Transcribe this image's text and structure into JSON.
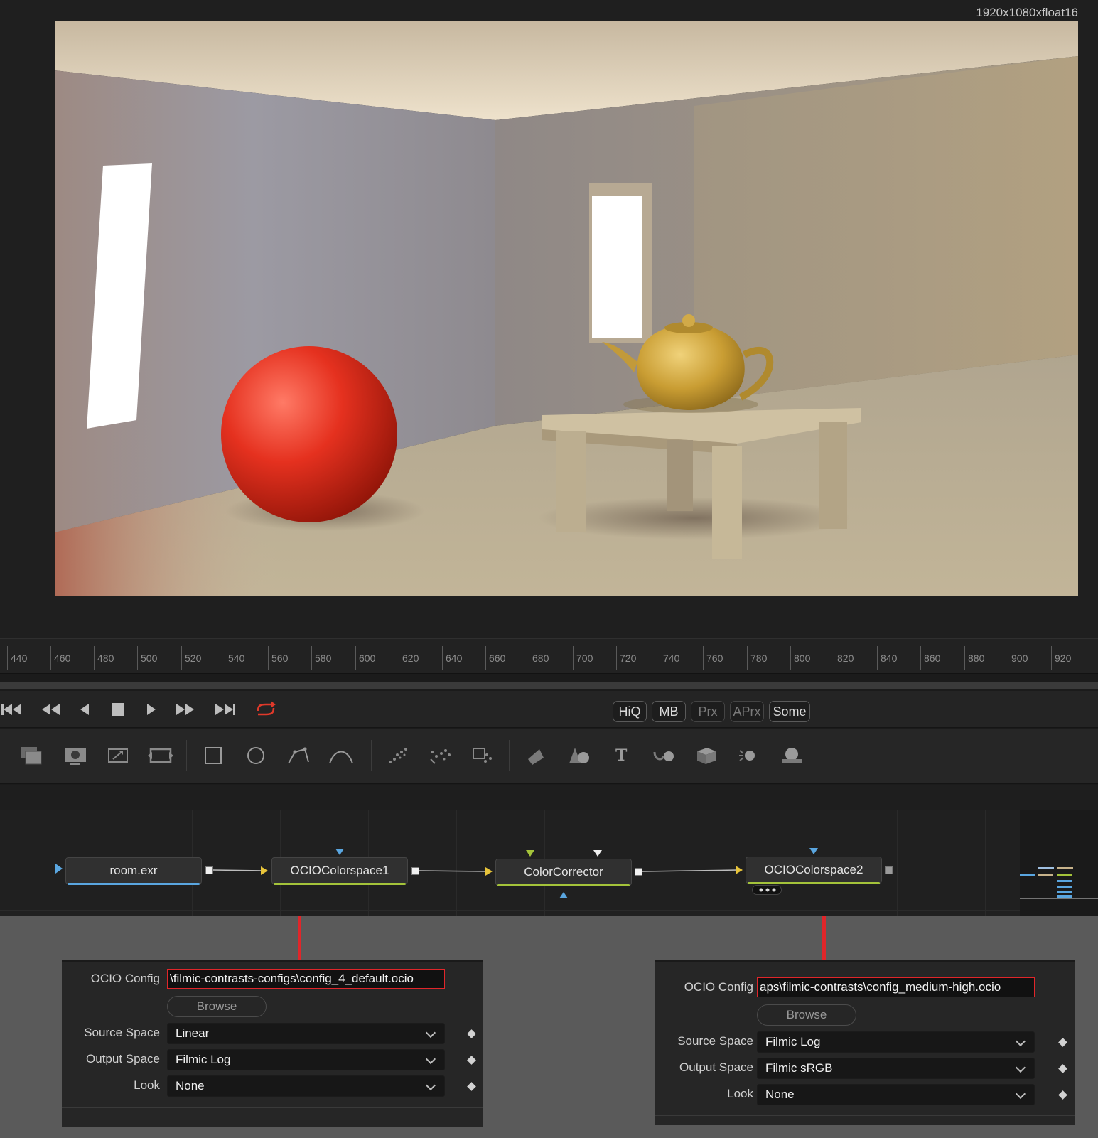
{
  "viewer": {
    "resolution_label": "1920x1080xfloat16"
  },
  "ruler": {
    "ticks": [
      "440",
      "460",
      "480",
      "500",
      "520",
      "540",
      "560",
      "580",
      "600",
      "620",
      "640",
      "660",
      "680",
      "700",
      "720",
      "740",
      "760",
      "780",
      "800",
      "820",
      "840",
      "860",
      "880",
      "900",
      "920"
    ]
  },
  "transport": {
    "buttons": [
      "go-to-start",
      "step-back-fast",
      "play-reverse",
      "stop",
      "play",
      "step-forward-fast",
      "go-to-end",
      "loop"
    ],
    "quality": {
      "hiq": "HiQ",
      "mb": "MB",
      "prx": "Prx",
      "aprx": "APrx",
      "some": "Some"
    }
  },
  "nodes": {
    "room": "room.exr",
    "ocio1": "OCIOColorspace1",
    "cc": "ColorCorrector",
    "ocio2": "OCIOColorspace2"
  },
  "panel_left": {
    "ocio_config_label": "OCIO Config",
    "ocio_config_value": "\\filmic-contrasts-configs\\config_4_default.ocio",
    "browse": "Browse",
    "source_space_label": "Source Space",
    "source_space_value": "Linear",
    "output_space_label": "Output Space",
    "output_space_value": "Filmic Log",
    "look_label": "Look",
    "look_value": "None"
  },
  "panel_right": {
    "ocio_config_label": "OCIO Config",
    "ocio_config_value": "aps\\filmic-contrasts\\config_medium-high.ocio",
    "browse": "Browse",
    "source_space_label": "Source Space",
    "source_space_value": "Filmic Log",
    "output_space_label": "Output Space",
    "output_space_value": "Filmic sRGB",
    "look_label": "Look",
    "look_value": "None"
  },
  "colors": {
    "accent_red": "#e0262a",
    "node_blue": "#5aa6e0",
    "node_green": "#a4c33a"
  }
}
